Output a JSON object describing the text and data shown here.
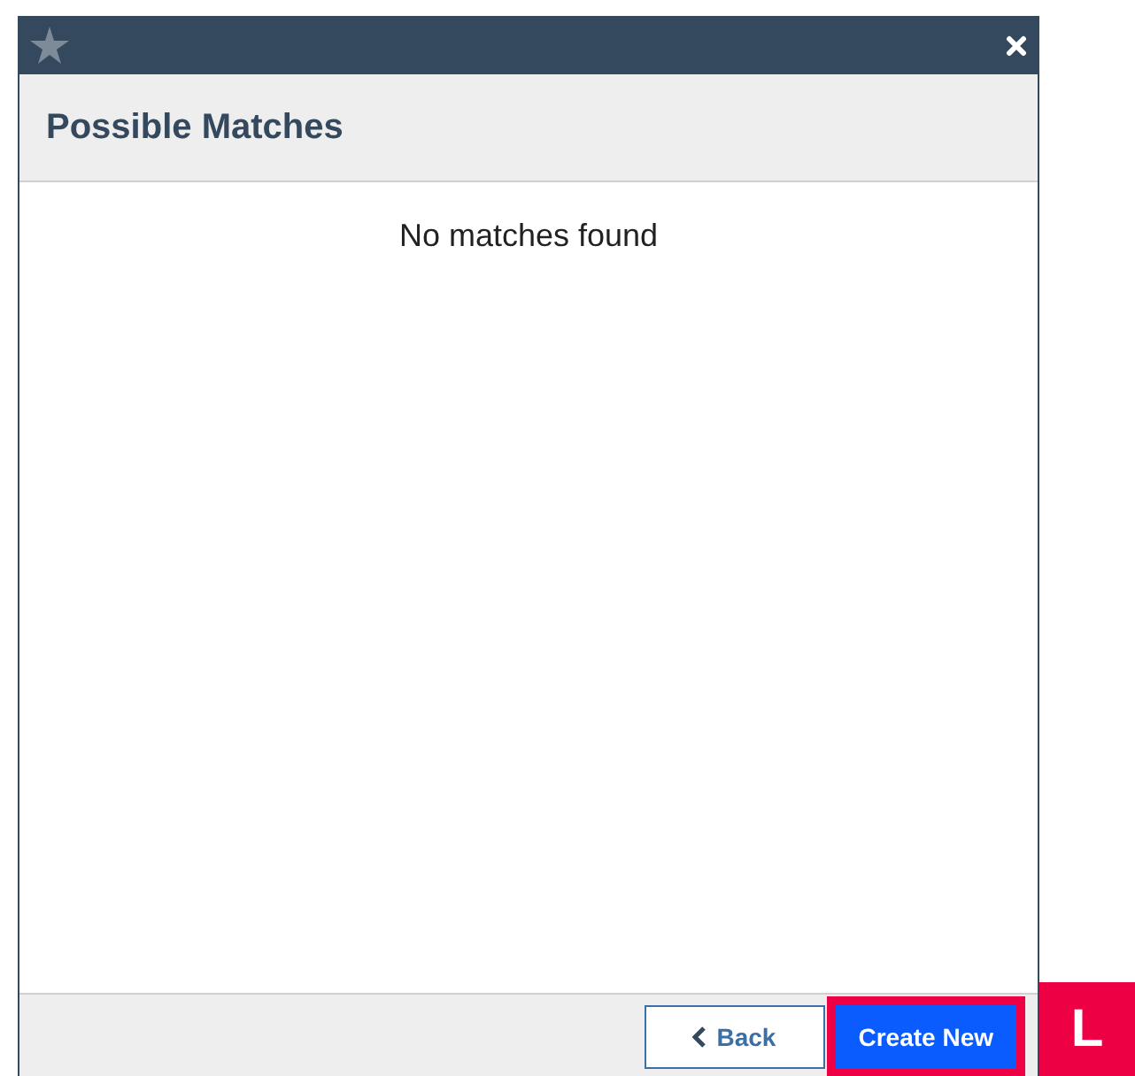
{
  "dialog": {
    "title": "Possible Matches",
    "message": "No matches found",
    "buttons": [
      {
        "label": "Back",
        "kind": "secondary",
        "highlighted": false
      },
      {
        "label": "Create New",
        "kind": "primary",
        "highlighted": true
      }
    ]
  },
  "annotation": {
    "label": "L"
  }
}
